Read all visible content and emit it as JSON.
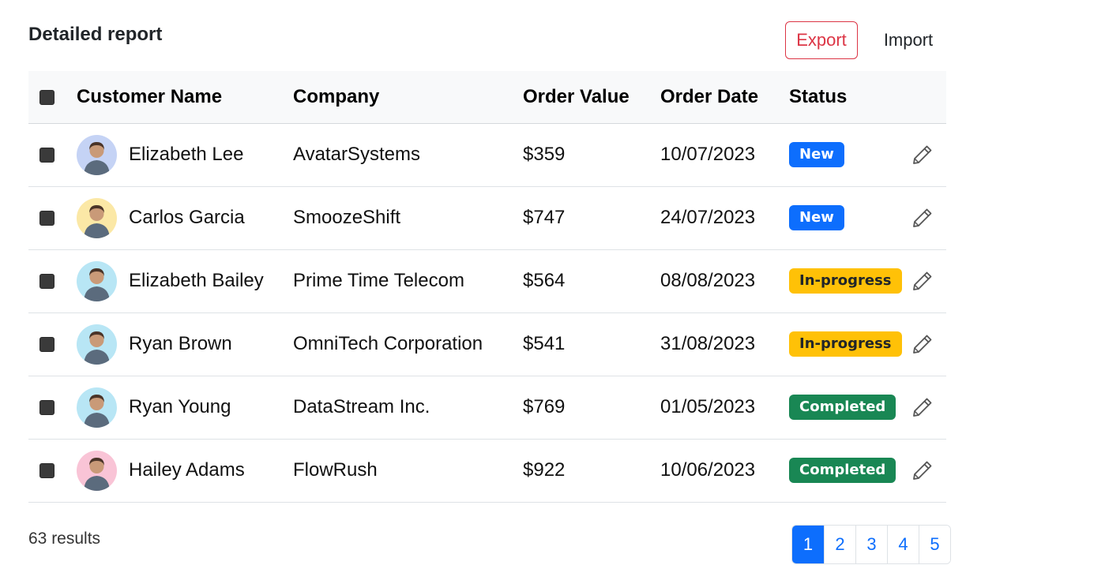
{
  "header": {
    "title": "Detailed report",
    "export_label": "Export",
    "import_label": "Import"
  },
  "table": {
    "columns": [
      "Customer Name",
      "Company",
      "Order Value",
      "Order Date",
      "Status"
    ],
    "rows": [
      {
        "name": "Elizabeth Lee",
        "company": "AvatarSystems",
        "value": "$359",
        "date": "10/07/2023",
        "status": "New",
        "avatar_bg": "#c5d3f5"
      },
      {
        "name": "Carlos Garcia",
        "company": "SmoozeShift",
        "value": "$747",
        "date": "24/07/2023",
        "status": "New",
        "avatar_bg": "#fbe8a6"
      },
      {
        "name": "Elizabeth Bailey",
        "company": "Prime Time Telecom",
        "value": "$564",
        "date": "08/08/2023",
        "status": "In-progress",
        "avatar_bg": "#b8e6f5"
      },
      {
        "name": "Ryan Brown",
        "company": "OmniTech Corporation",
        "value": "$541",
        "date": "31/08/2023",
        "status": "In-progress",
        "avatar_bg": "#b8e6f5"
      },
      {
        "name": "Ryan Young",
        "company": "DataStream Inc.",
        "value": "$769",
        "date": "01/05/2023",
        "status": "Completed",
        "avatar_bg": "#b8e6f5"
      },
      {
        "name": "Hailey Adams",
        "company": "FlowRush",
        "value": "$922",
        "date": "10/06/2023",
        "status": "Completed",
        "avatar_bg": "#f9c4d6"
      }
    ]
  },
  "footer": {
    "results_text": "63 results",
    "pages": [
      "1",
      "2",
      "3",
      "4",
      "5"
    ],
    "active_page": "1"
  },
  "colors": {
    "accent": "#0d6efd",
    "danger": "#dc3545",
    "status_new": "#0d6efd",
    "status_in_progress": "#ffc107",
    "status_completed": "#198754"
  },
  "icons": {
    "edit": "pencil-icon",
    "checkbox": "checkbox-icon"
  }
}
